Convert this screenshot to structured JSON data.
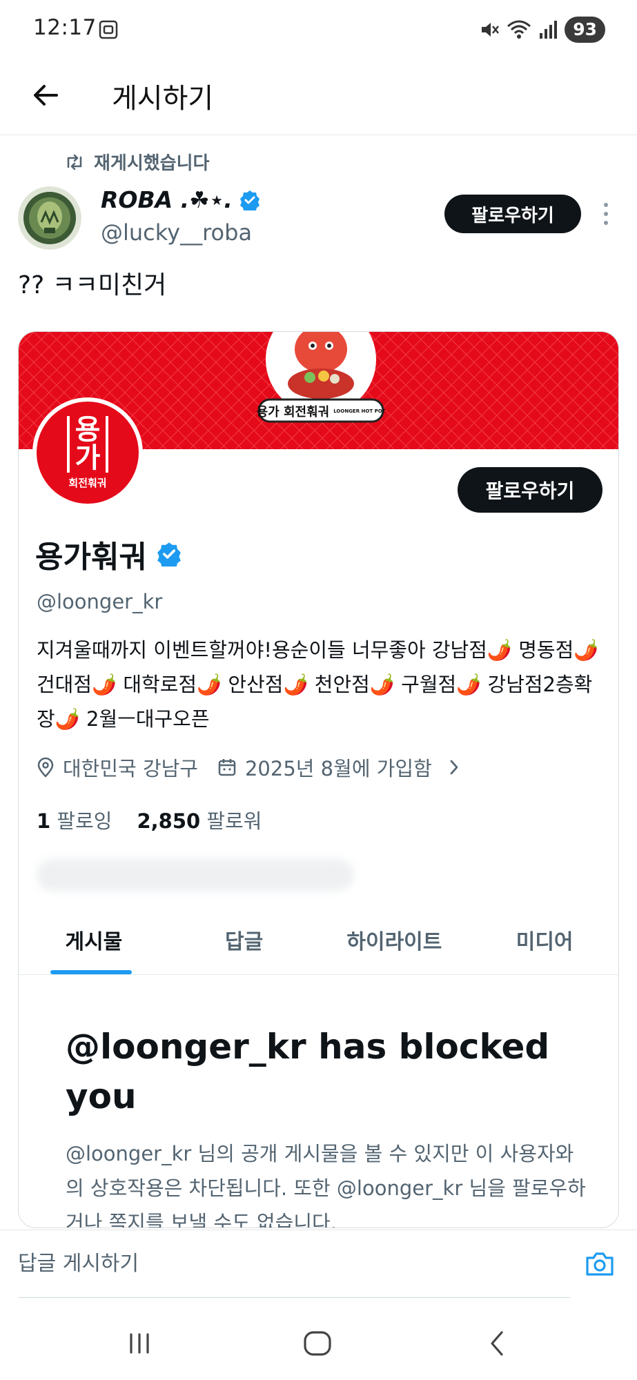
{
  "status_bar": {
    "time": "12:17",
    "battery": "93",
    "icons": [
      "screencast-icon",
      "mute-icon",
      "wifi-icon",
      "signal-icon"
    ]
  },
  "header": {
    "title": "게시하기",
    "back_icon": "arrow-left-icon"
  },
  "repost": {
    "label": "재게시했습니다",
    "icon": "repost-icon"
  },
  "post": {
    "author_name": "ROBA .☘︎⋆.",
    "author_handle": "@lucky__roba",
    "follow_label": "팔로우하기",
    "text": "?? ㅋㅋ미친거"
  },
  "profile_card": {
    "banner_color": "#e50a1a",
    "banner_logo_text": "용가 회전훠궈",
    "banner_logo_small": "LOONGER HOT POT",
    "avatar_top": "용",
    "avatar_mid": "가",
    "avatar_bottom": "회전훠궈",
    "follow_label": "팔로우하기",
    "name": "용가훠궈",
    "handle": "@loonger_kr",
    "bio": "지겨울때까지 이벤트할꺼야!용순이들 너무좋아 강남점🌶️ 명동점🌶️ 건대점🌶️ 대학로점🌶️ 안산점🌶️ 천안점🌶️ 구월점🌶️ 강남점2층확장🌶️ 2월ㅡ대구오픈",
    "location": "대한민국 강남구",
    "joined": "2025년 8월에 가입함",
    "following_count": "1",
    "following_label": "팔로잉",
    "followers_count": "2,850",
    "followers_label": "팔로워",
    "tabs": [
      {
        "label": "게시물",
        "active": true
      },
      {
        "label": "답글",
        "active": false
      },
      {
        "label": "하이라이트",
        "active": false
      },
      {
        "label": "미디어",
        "active": false
      }
    ],
    "blocked_title": "@loonger_kr has blocked you",
    "blocked_desc": "@loonger_kr 님의 공개 게시물을 볼 수 있지만 이 사용자와의 상호작용은 차단됩니다. 또한 @loonger_kr 님을 팔로우하거나 쪽지를 보낼 수도 없습니다."
  },
  "reply": {
    "placeholder": "답글 게시하기",
    "camera_icon": "camera-icon"
  },
  "nav": {
    "icons": [
      "recent-apps-icon",
      "home-icon",
      "back-icon"
    ]
  },
  "colors": {
    "accent": "#1d9bf0",
    "verified": "#1d9bf0",
    "button_bg": "#0f1419",
    "secondary_text": "#536471"
  }
}
